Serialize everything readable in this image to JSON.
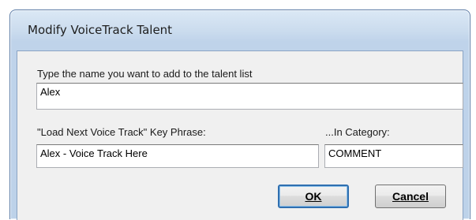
{
  "window": {
    "title": "Modify VoiceTrack Talent"
  },
  "form": {
    "talent_prompt": "Type the name you want to add to the talent list",
    "talent_value": "Alex",
    "key_phrase_label": "\"Load Next Voice Track\" Key Phrase:",
    "key_phrase_value": "Alex - Voice Track Here",
    "category_label": "...In Category:",
    "category_value": "COMMENT"
  },
  "buttons": {
    "ok_mnemonic": "O",
    "ok_rest": "K",
    "cancel_mnemonic": "C",
    "cancel_rest": "ancel"
  }
}
